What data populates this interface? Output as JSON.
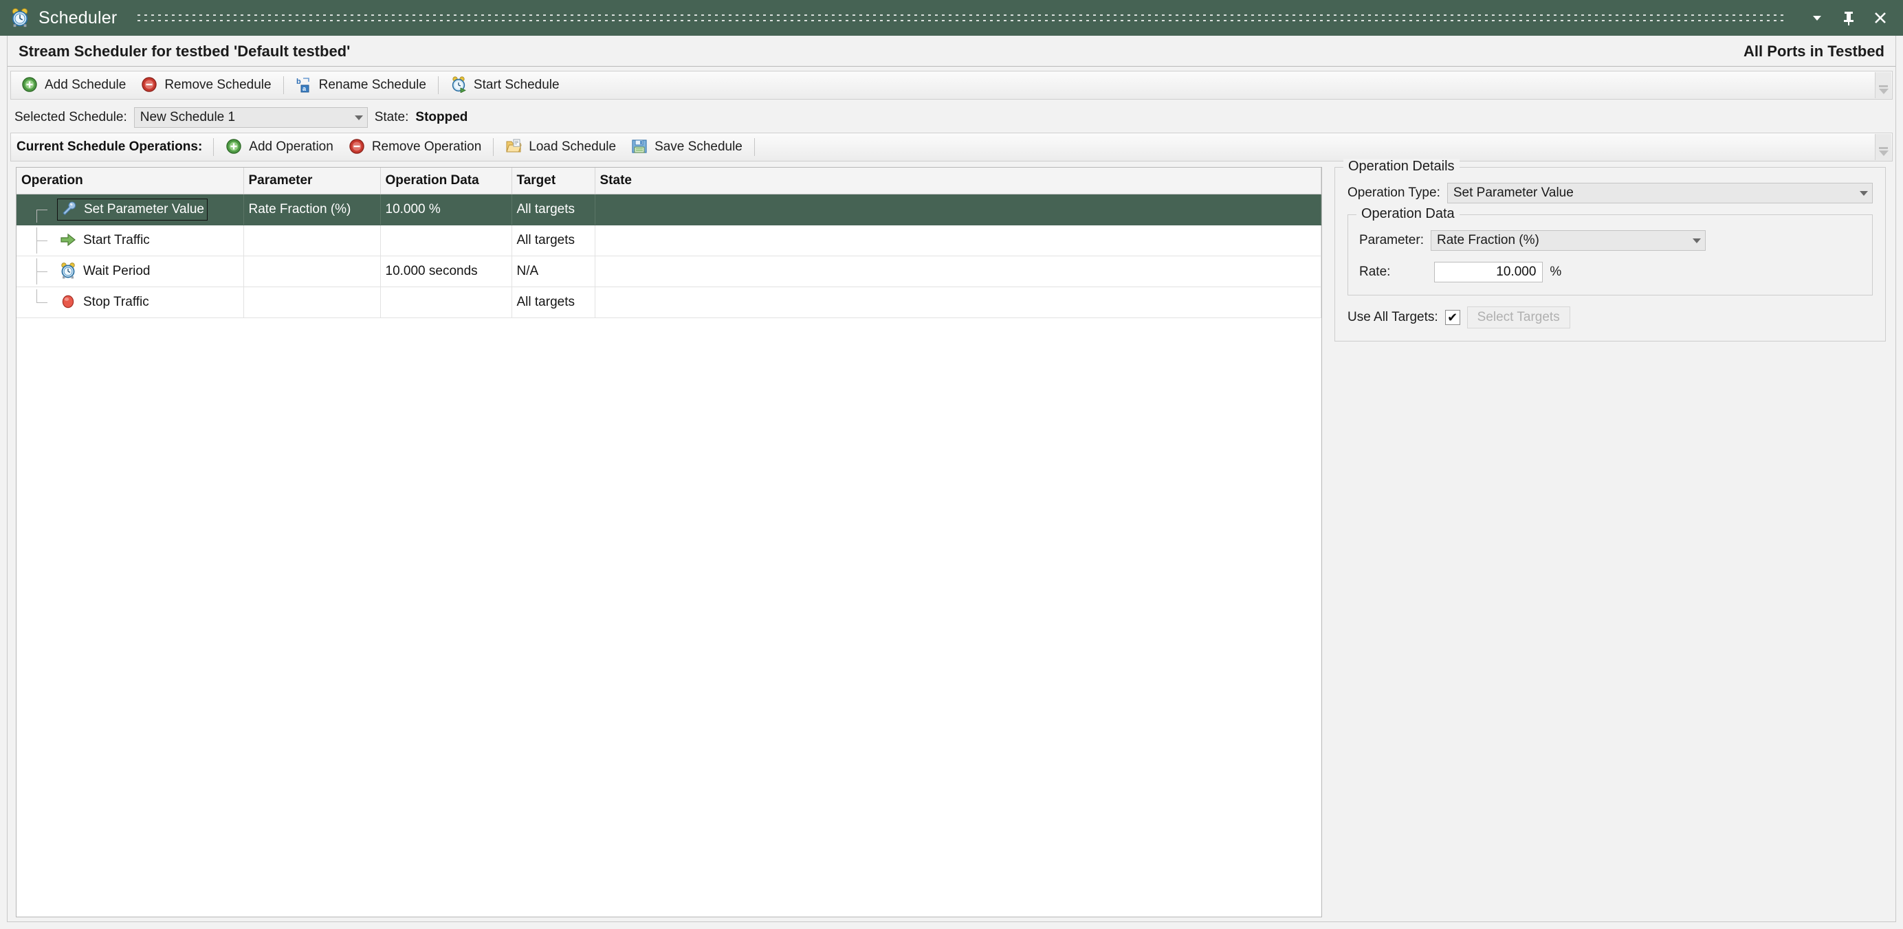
{
  "titlebar": {
    "title": "Scheduler",
    "icon": "alarm-clock-icon",
    "buttons": {
      "menu": "▾",
      "pin": "Pin",
      "close": "✕"
    }
  },
  "header": {
    "title": "Stream Scheduler for testbed 'Default testbed'",
    "scope": "All Ports in Testbed"
  },
  "schedule_toolbar": {
    "items": [
      {
        "label": "Add Schedule",
        "icon": "add-green-circle-icon"
      },
      {
        "label": "Remove Schedule",
        "icon": "remove-red-circle-icon"
      },
      {
        "label": "Rename Schedule",
        "icon": "rename-ba-icon"
      },
      {
        "label": "Start Schedule",
        "icon": "start-clock-icon"
      }
    ]
  },
  "selected_schedule": {
    "label": "Selected Schedule:",
    "value": "New Schedule 1",
    "state_label": "State:",
    "state_value": "Stopped"
  },
  "operations_toolbar": {
    "label": "Current Schedule Operations:",
    "items": [
      {
        "label": "Add Operation",
        "icon": "add-green-circle-icon"
      },
      {
        "label": "Remove Operation",
        "icon": "remove-red-circle-icon"
      },
      {
        "label": "Load Schedule",
        "icon": "open-folder-icon"
      },
      {
        "label": "Save Schedule",
        "icon": "floppy-disk-icon"
      }
    ]
  },
  "operations_table": {
    "columns": [
      "Operation",
      "Parameter",
      "Operation Data",
      "Target",
      "State"
    ],
    "rows": [
      {
        "operation": "Set Parameter Value",
        "icon": "wrench-icon",
        "parameter": "Rate Fraction (%)",
        "operation_data": "10.000 %",
        "target": "All targets",
        "state": "",
        "selected": true
      },
      {
        "operation": "Start Traffic",
        "icon": "green-arrow-icon",
        "parameter": "",
        "operation_data": "",
        "target": "All targets",
        "state": "",
        "selected": false
      },
      {
        "operation": "Wait Period",
        "icon": "alarm-clock-icon",
        "parameter": "",
        "operation_data": "10.000 seconds",
        "target": "N/A",
        "state": "",
        "selected": false
      },
      {
        "operation": "Stop Traffic",
        "icon": "red-stop-icon",
        "parameter": "",
        "operation_data": "",
        "target": "All targets",
        "state": "",
        "selected": false
      }
    ]
  },
  "operation_details": {
    "group_title": "Operation Details",
    "operation_type_label": "Operation Type:",
    "operation_type_value": "Set Parameter Value",
    "operation_data": {
      "group_title": "Operation Data",
      "parameter_label": "Parameter:",
      "parameter_value": "Rate Fraction (%)",
      "rate_label": "Rate:",
      "rate_value": "10.000",
      "rate_unit": "%"
    },
    "use_all_targets_label": "Use All Targets:",
    "use_all_targets_checked": "✔",
    "select_targets_label": "Select Targets"
  },
  "colors": {
    "accent_green": "#466354",
    "selected_row": "#466354",
    "window_bg": "#f2f2f2",
    "toolbar_bg": "#ececec"
  }
}
